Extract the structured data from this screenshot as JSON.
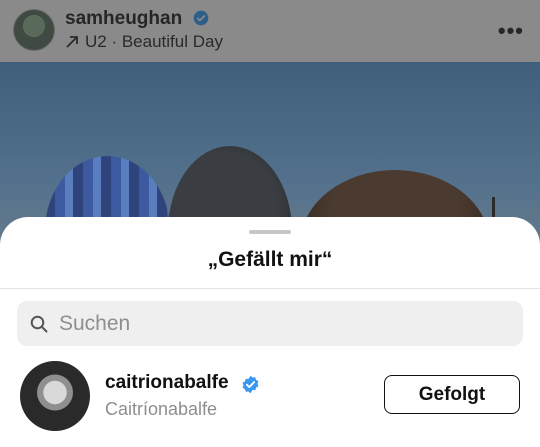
{
  "post": {
    "username": "samheughan",
    "music": "U2 · Beautiful Day",
    "more_label": "•••"
  },
  "sheet": {
    "title": "„Gefällt mir“",
    "search_placeholder": "Suchen"
  },
  "likes": [
    {
      "username": "caitrionabalfe",
      "display_name": "Caitríonabalfe",
      "verified": true,
      "button_label": "Gefolgt"
    }
  ],
  "colors": {
    "verified_blue": "#3897f0",
    "dim_overlay": "#7a7a7a"
  }
}
